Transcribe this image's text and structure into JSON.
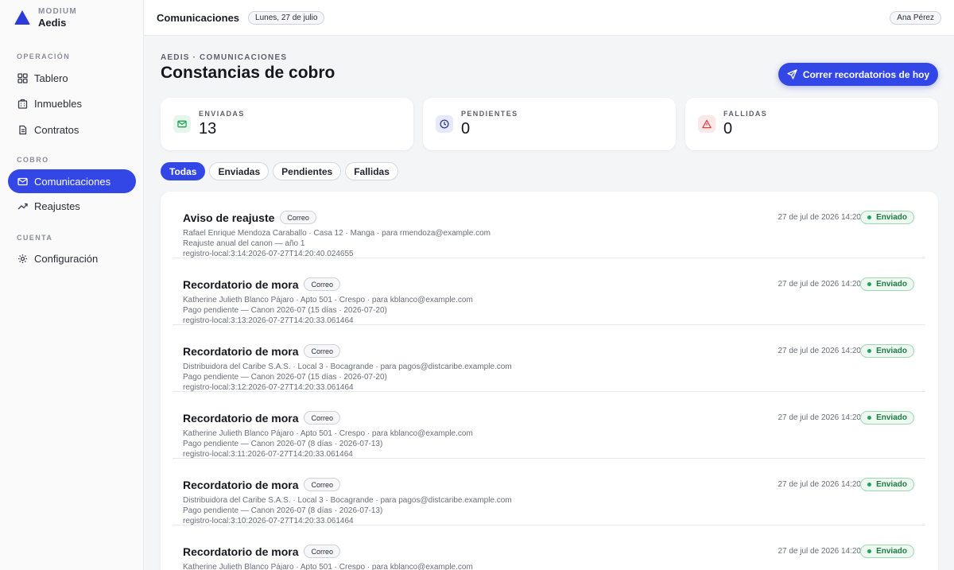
{
  "brand": {
    "org": "MODIUM",
    "name": "Aedis"
  },
  "sidebar": {
    "sections": [
      {
        "label": "OPERACIÓN",
        "items": [
          {
            "label": "Tablero",
            "icon": "grid-icon"
          },
          {
            "label": "Inmuebles",
            "icon": "building-icon"
          },
          {
            "label": "Contratos",
            "icon": "contract-icon"
          }
        ]
      },
      {
        "label": "COBRO",
        "items": [
          {
            "label": "Comunicaciones",
            "icon": "mail-icon",
            "active": true
          },
          {
            "label": "Reajustes",
            "icon": "trend-icon"
          }
        ]
      },
      {
        "label": "CUENTA",
        "items": [
          {
            "label": "Configuración",
            "icon": "gear-icon"
          }
        ]
      }
    ]
  },
  "topbar": {
    "title": "Comunicaciones",
    "date": "Lunes, 27 de julio",
    "user": "Ana Pérez"
  },
  "main": {
    "breadcrumb": "AEDIS · COMUNICACIONES",
    "title": "Constancias de cobro",
    "run_button": "Correr recordatorios de hoy",
    "stats": [
      {
        "label": "ENVIADAS",
        "value": "13",
        "icon": "mail-icon",
        "color": "#22a25a"
      },
      {
        "label": "PENDIENTES",
        "value": "0",
        "icon": "clock-icon",
        "color": "#3346e6"
      },
      {
        "label": "FALLIDAS",
        "value": "0",
        "icon": "warning-icon",
        "color": "#d64545"
      }
    ],
    "filters": [
      "Todas",
      "Enviadas",
      "Pendientes",
      "Fallidas"
    ],
    "active_filter": "Todas",
    "items": [
      {
        "title": "Aviso de reajuste",
        "channel": "Correo",
        "line1": "Rafael Enrique Mendoza Caraballo · Casa 12 · Manga · para rmendoza@example.com",
        "line2": "Reajuste anual del canon — año 1",
        "line3": "registro-local:3:14:2026-07-27T14:20:40.024655",
        "time": "27 de jul de 2026 14:20",
        "status": "Enviado"
      },
      {
        "title": "Recordatorio de mora",
        "channel": "Correo",
        "line1": "Katherine Julieth Blanco Pájaro · Apto 501 · Crespo · para kblanco@example.com",
        "line2": "Pago pendiente — Canon 2026-07 (15 días · 2026-07-20)",
        "line3": "registro-local:3:13:2026-07-27T14:20:33.061464",
        "time": "27 de jul de 2026 14:20",
        "status": "Enviado"
      },
      {
        "title": "Recordatorio de mora",
        "channel": "Correo",
        "line1": "Distribuidora del Caribe S.A.S. · Local 3 · Bocagrande · para pagos@distcaribe.example.com",
        "line2": "Pago pendiente — Canon 2026-07 (15 días · 2026-07-20)",
        "line3": "registro-local:3:12:2026-07-27T14:20:33.061464",
        "time": "27 de jul de 2026 14:20",
        "status": "Enviado"
      },
      {
        "title": "Recordatorio de mora",
        "channel": "Correo",
        "line1": "Katherine Julieth Blanco Pájaro · Apto 501 · Crespo · para kblanco@example.com",
        "line2": "Pago pendiente — Canon 2026-07 (8 días · 2026-07-13)",
        "line3": "registro-local:3:11:2026-07-27T14:20:33.061464",
        "time": "27 de jul de 2026 14:20",
        "status": "Enviado"
      },
      {
        "title": "Recordatorio de mora",
        "channel": "Correo",
        "line1": "Distribuidora del Caribe S.A.S. · Local 3 · Bocagrande · para pagos@distcaribe.example.com",
        "line2": "Pago pendiente — Canon 2026-07 (8 días · 2026-07-13)",
        "line3": "registro-local:3:10:2026-07-27T14:20:33.061464",
        "time": "27 de jul de 2026 14:20",
        "status": "Enviado"
      },
      {
        "title": "Recordatorio de mora",
        "channel": "Correo",
        "line1": "Katherine Julieth Blanco Pájaro · Apto 501 · Crespo · para kblanco@example.com",
        "line2": "",
        "line3": "",
        "time": "27 de jul de 2026 14:20",
        "status": "Enviado"
      }
    ]
  }
}
